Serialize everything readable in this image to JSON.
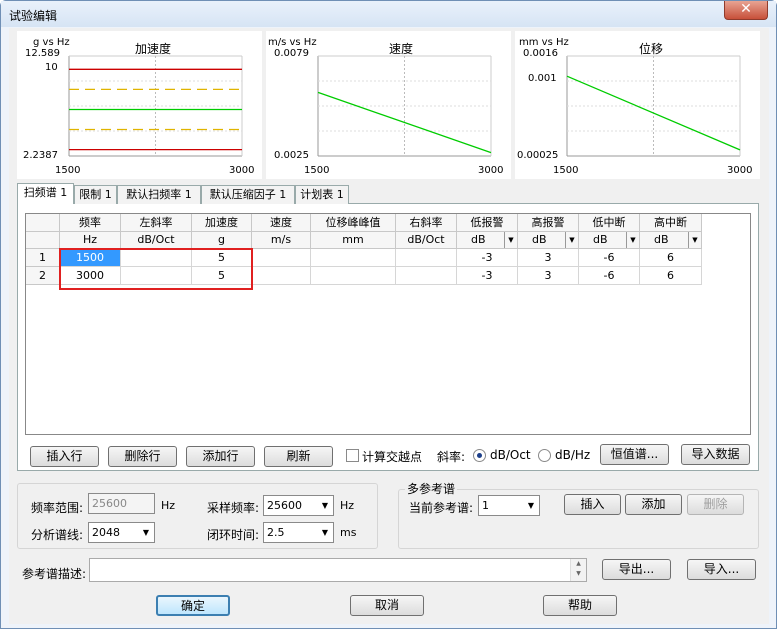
{
  "window": {
    "title": "试验编辑",
    "close_glyph": "✕"
  },
  "charts": [
    {
      "ylabel": "g vs Hz",
      "title": "加速度",
      "ymax_label": "12.589",
      "ytick_label": "10",
      "ymin_label": "2.2387",
      "xmin_label": "1500",
      "xmax_label": "3000",
      "chart_data": {
        "type": "line",
        "x": [
          1500,
          3000
        ],
        "xlim": [
          1500,
          3000
        ],
        "ylim": [
          2.2387,
          12.589
        ],
        "yscale": "log",
        "ylabel": "g vs Hz",
        "title": "加速度",
        "series": [
          {
            "values": [
              5,
              5
            ],
            "color": "#00cc00",
            "style": "solid"
          },
          {
            "values": [
              7.07,
              7.07
            ],
            "color": "#e0b400",
            "style": "dashed"
          },
          {
            "values": [
              3.54,
              3.54
            ],
            "color": "#e0b400",
            "style": "dashed"
          },
          {
            "values": [
              10,
              10
            ],
            "color": "#cc0000",
            "style": "solid"
          },
          {
            "values": [
              2.5,
              2.5
            ],
            "color": "#cc0000",
            "style": "solid"
          }
        ]
      }
    },
    {
      "ylabel": "m/s vs Hz",
      "title": "速度",
      "ymax_label": "0.0079",
      "ymin_label": "0.0025",
      "xmin_label": "1500",
      "xmax_label": "3000",
      "chart_data": {
        "type": "line",
        "x": [
          1500,
          3000
        ],
        "xlim": [
          1500,
          3000
        ],
        "ylim": [
          0.0025,
          0.0079
        ],
        "yscale": "log",
        "ylabel": "m/s vs Hz",
        "title": "速度",
        "series": [
          {
            "values": [
              0.0052,
              0.0026
            ],
            "color": "#00cc00",
            "style": "solid"
          }
        ]
      }
    },
    {
      "ylabel": "mm vs Hz",
      "title": "位移",
      "ymax_label": "0.0016",
      "ytick_label": "0.001",
      "ymin_label": "0.00025",
      "xmin_label": "1500",
      "xmax_label": "3000",
      "chart_data": {
        "type": "line",
        "x": [
          1500,
          3000
        ],
        "xlim": [
          1500,
          3000
        ],
        "ylim": [
          0.00025,
          0.0016
        ],
        "yscale": "log",
        "ylabel": "mm vs Hz",
        "title": "位移",
        "series": [
          {
            "values": [
              0.0011,
              0.00028
            ],
            "color": "#00cc00",
            "style": "solid"
          }
        ]
      }
    }
  ],
  "tabs": [
    "扫频谱 1",
    "限制 1",
    "默认扫频率 1",
    "默认压缩因子 1",
    "计划表 1"
  ],
  "table": {
    "headers": [
      "频率",
      "左斜率",
      "加速度",
      "速度",
      "位移峰峰值",
      "右斜率",
      "低报警",
      "高报警",
      "低中断",
      "高中断"
    ],
    "units": [
      "Hz",
      "dB/Oct",
      "g",
      "m/s",
      "mm",
      "dB/Oct",
      "dB",
      "dB",
      "dB",
      "dB"
    ],
    "rows": [
      {
        "num": "1",
        "cells": [
          "1500",
          "",
          "5",
          "",
          "",
          "",
          "-3",
          "3",
          "-6",
          "6"
        ]
      },
      {
        "num": "2",
        "cells": [
          "3000",
          "",
          "5",
          "",
          "",
          "",
          "-3",
          "3",
          "-6",
          "6"
        ]
      }
    ],
    "dropdown_glyph": "▼"
  },
  "toolbar": {
    "insert_row": "插入行",
    "delete_row": "删除行",
    "add_row": "添加行",
    "refresh": "刷新",
    "calc_cross": "计算交越点",
    "slope_label": "斜率:",
    "slope_opt1": "dB/Oct",
    "slope_opt2": "dB/Hz",
    "const_spectrum": "恒值谱...",
    "import_data": "导入数据"
  },
  "settings": {
    "freq_range_label": "频率范围:",
    "freq_range_value": "25600",
    "freq_unit": "Hz",
    "sample_rate_label": "采样频率:",
    "sample_rate_value": "25600",
    "sample_unit": "Hz",
    "lines_label": "分析谱线:",
    "lines_value": "2048",
    "loop_label": "闭环时间:",
    "loop_value": "2.5",
    "loop_unit": "ms"
  },
  "multiref": {
    "group_title": "多参考谱",
    "current_label": "当前参考谱:",
    "current_value": "1",
    "insert": "插入",
    "add": "添加",
    "delete": "删除"
  },
  "refdesc": {
    "label": "参考谱描述:",
    "value": "",
    "export": "导出...",
    "import": "导入..."
  },
  "footer": {
    "ok": "确定",
    "cancel": "取消",
    "help": "帮助"
  }
}
